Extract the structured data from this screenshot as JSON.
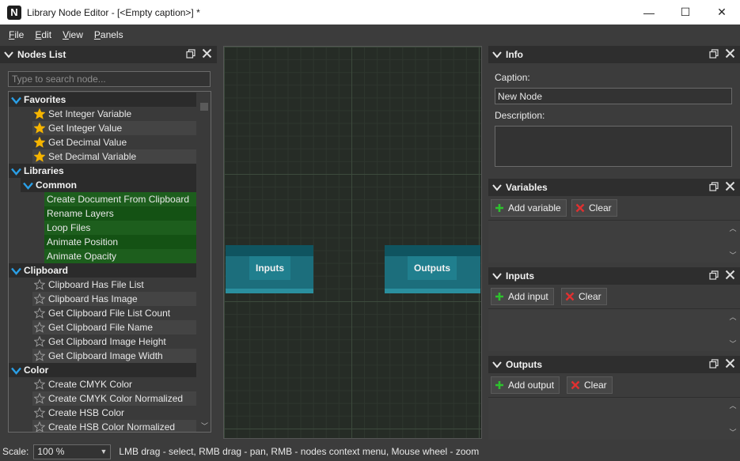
{
  "window": {
    "title": "Library Node Editor - [<Empty caption>] *",
    "app_icon_letter": "N",
    "minimize_glyph": "—",
    "maximize_glyph": "☐",
    "close_glyph": "✕"
  },
  "menu": [
    {
      "u": "F",
      "rest": "ile"
    },
    {
      "u": "E",
      "rest": "dit"
    },
    {
      "u": "V",
      "rest": "iew"
    },
    {
      "u": "P",
      "rest": "anels"
    }
  ],
  "nodes_list": {
    "title": "Nodes List",
    "search_placeholder": "Type to search node...",
    "rows": [
      {
        "kind": "cat",
        "label": "Favorites",
        "indent": 0
      },
      {
        "kind": "item",
        "label": "Set Integer Variable",
        "icon": "star-filled",
        "alt": false
      },
      {
        "kind": "item",
        "label": "Get Integer Value",
        "icon": "star-filled",
        "alt": true
      },
      {
        "kind": "item",
        "label": "Get Decimal Value",
        "icon": "star-filled",
        "alt": false
      },
      {
        "kind": "item",
        "label": "Set Decimal Variable",
        "icon": "star-filled",
        "alt": true
      },
      {
        "kind": "cat",
        "label": "Libraries",
        "indent": 0
      },
      {
        "kind": "cat",
        "label": "Common",
        "indent": 1
      },
      {
        "kind": "green",
        "label": "Create Document From Clipboard",
        "alt": false
      },
      {
        "kind": "green",
        "label": "Rename Layers",
        "alt": true
      },
      {
        "kind": "green",
        "label": "Loop Files",
        "alt": false
      },
      {
        "kind": "green",
        "label": "Animate Position",
        "alt": true
      },
      {
        "kind": "green",
        "label": "Animate Opacity",
        "alt": false
      },
      {
        "kind": "cat",
        "label": "Clipboard",
        "indent": 0
      },
      {
        "kind": "item",
        "label": "Clipboard Has File List",
        "icon": "star-outline",
        "alt": false
      },
      {
        "kind": "item",
        "label": "Clipboard Has Image",
        "icon": "star-outline",
        "alt": true
      },
      {
        "kind": "item",
        "label": "Get Clipboard File List Count",
        "icon": "star-outline",
        "alt": false
      },
      {
        "kind": "item",
        "label": "Get Clipboard File Name",
        "icon": "star-outline",
        "alt": true
      },
      {
        "kind": "item",
        "label": "Get Clipboard Image Height",
        "icon": "star-outline",
        "alt": false
      },
      {
        "kind": "item",
        "label": "Get Clipboard Image Width",
        "icon": "star-outline",
        "alt": true
      },
      {
        "kind": "cat",
        "label": "Color",
        "indent": 0
      },
      {
        "kind": "item",
        "label": "Create CMYK Color",
        "icon": "star-outline",
        "alt": false
      },
      {
        "kind": "item",
        "label": "Create CMYK Color Normalized",
        "icon": "star-outline",
        "alt": true
      },
      {
        "kind": "item",
        "label": "Create HSB Color",
        "icon": "star-outline",
        "alt": false
      },
      {
        "kind": "item",
        "label": "Create HSB Color Normalized",
        "icon": "star-outline",
        "alt": true
      }
    ]
  },
  "canvas": {
    "input_node": "Inputs",
    "output_node": "Outputs"
  },
  "info": {
    "title": "Info",
    "caption_label": "Caption:",
    "caption_value": "New Node",
    "description_label": "Description:",
    "description_value": ""
  },
  "variables": {
    "title": "Variables",
    "add_label": "Add variable",
    "clear_label": "Clear"
  },
  "inputs": {
    "title": "Inputs",
    "add_label": "Add input",
    "clear_label": "Clear"
  },
  "outputs": {
    "title": "Outputs",
    "add_label": "Add output",
    "clear_label": "Clear"
  },
  "status": {
    "scale_label": "Scale:",
    "scale_value": "100 %",
    "hint": "LMB drag - select, RMB drag - pan, RMB - nodes context menu, Mouse wheel - zoom"
  },
  "colors": {
    "accent_blue": "#1e9be0",
    "star_gold": "#f5b400",
    "node_teal": "#1c6e7c",
    "add_green": "#2ec12e",
    "clear_red": "#e03030"
  }
}
